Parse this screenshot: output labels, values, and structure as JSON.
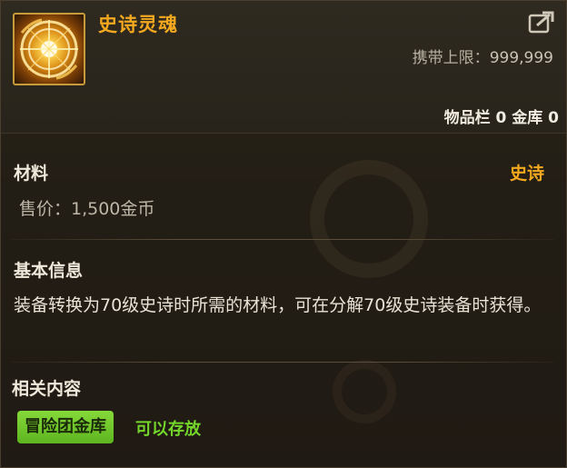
{
  "item": {
    "name": "史诗灵魂",
    "icon": "epic-soul-icon"
  },
  "header": {
    "carry_limit_label": "携带上限：",
    "carry_limit_value": "999,999",
    "inventory_count": "物品栏 0 金库 0"
  },
  "material": {
    "type_label": "材料",
    "rarity": "史诗",
    "price": "售价：1,500金币"
  },
  "basic_info": {
    "title": "基本信息",
    "description": "装备转换为70级史诗时所需的材料，可在分解70级史诗装备时获得。"
  },
  "related": {
    "title": "相关内容",
    "storage_tag": "冒险团金库",
    "storage_status": "可以存放"
  },
  "colors": {
    "rarity_epic": "#f3a81f",
    "storage_green": "#74d62b",
    "tag_green": "#6cc229"
  }
}
